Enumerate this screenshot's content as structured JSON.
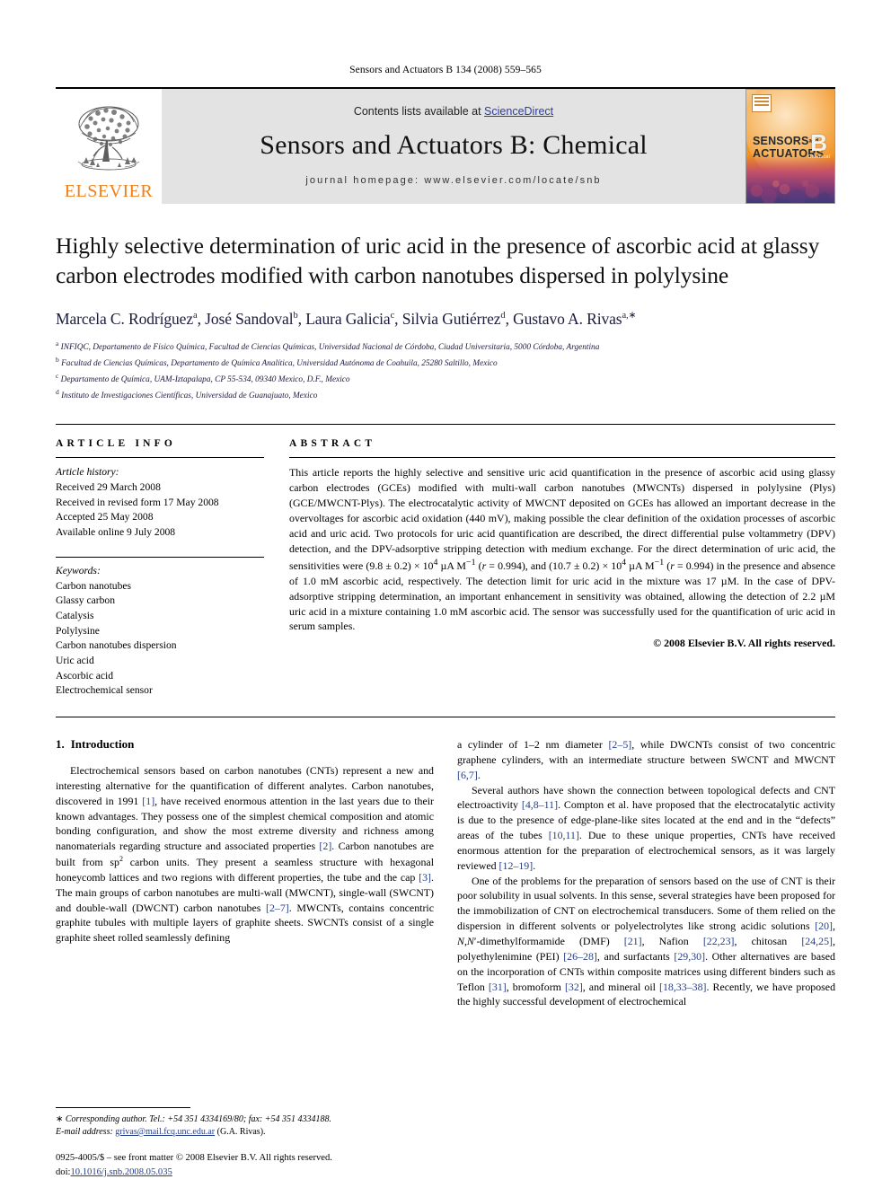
{
  "running_head": "Sensors and Actuators B 134 (2008) 559–565",
  "masthead": {
    "publisher_name": "ELSEVIER",
    "contents_prefix": "Contents lists available at ",
    "contents_link": "ScienceDirect",
    "journal_title": "Sensors and Actuators B: Chemical",
    "homepage_line": "journal homepage: www.elsevier.com/locate/snb",
    "cover": {
      "line1": "SENSORS",
      "and": "and",
      "line2": "ACTUATORS",
      "series": "B",
      "subtitle": "Chemical"
    }
  },
  "article": {
    "title": "Highly selective determination of uric acid in the presence of ascorbic acid at glassy carbon electrodes modified with carbon nanotubes dispersed in polylysine",
    "authors_html": "Marcela C. Rodríguez<sup>a</sup>, José Sandoval<sup>b</sup>, Laura Galicia<sup>c</sup>, Silvia Gutiérrez<sup>d</sup>, Gustavo A. Rivas<sup>a,</sup><sup class=\"star\">∗</sup>",
    "affiliations": [
      {
        "marker": "a",
        "text": "INFIQC, Departamento de Físico Química, Facultad de Ciencias Químicas, Universidad Nacional de Córdoba, Ciudad Universitaria, 5000 Córdoba, Argentina"
      },
      {
        "marker": "b",
        "text": "Facultad de Ciencias Químicas, Departamento de Química Analítica, Universidad Autónoma de Coahuila, 25280 Saltillo, Mexico"
      },
      {
        "marker": "c",
        "text": "Departamento de Química, UAM-Iztapalapa, CP 55-534, 09340 Mexico, D.F., Mexico"
      },
      {
        "marker": "d",
        "text": "Instituto de Investigaciones Científicas, Universidad de Guanajuato, Mexico"
      }
    ]
  },
  "article_info": {
    "heading": "ARTICLE INFO",
    "history_label": "Article history:",
    "history": [
      "Received 29 March 2008",
      "Received in revised form 17 May 2008",
      "Accepted 25 May 2008",
      "Available online 9 July 2008"
    ],
    "keywords_label": "Keywords:",
    "keywords": [
      "Carbon nanotubes",
      "Glassy carbon",
      "Catalysis",
      "Polylysine",
      "Carbon nanotubes dispersion",
      "Uric acid",
      "Ascorbic acid",
      "Electrochemical sensor"
    ]
  },
  "abstract": {
    "heading": "ABSTRACT",
    "text_html": "This article reports the highly selective and sensitive uric acid quantification in the presence of ascorbic acid using glassy carbon electrodes (GCEs) modified with multi-wall carbon nanotubes (MWCNTs) dispersed in polylysine (Plys) (GCE/MWCNT-Plys). The electrocatalytic activity of MWCNT deposited on GCEs has allowed an important decrease in the overvoltages for ascorbic acid oxidation (440 mV), making possible the clear definition of the oxidation processes of ascorbic acid and uric acid. Two protocols for uric acid quantification are described, the direct differential pulse voltammetry (DPV) detection, and the DPV-adsorptive stripping detection with medium exchange. For the direct determination of uric acid, the sensitivities were (9.8 ± 0.2) × 10<sup>4</sup> &micro;A M<sup>−1</sup> (<i>r</i> = 0.994), and (10.7 ± 0.2) × 10<sup>4</sup> &micro;A M<sup>−1</sup> (<i>r</i> = 0.994) in the presence and absence of 1.0 mM ascorbic acid, respectively. The detection limit for uric acid in the mixture was 17 &micro;M. In the case of DPV-adsorptive stripping determination, an important enhancement in sensitivity was obtained, allowing the detection of 2.2 &micro;M uric acid in a mixture containing 1.0 mM ascorbic acid. The sensor was successfully used for the quantification of uric acid in serum samples.",
    "copyright": "© 2008 Elsevier B.V. All rights reserved."
  },
  "introduction": {
    "number": "1.",
    "heading": "Introduction",
    "left_paragraphs_html": [
      "Electrochemical sensors based on carbon nanotubes (CNTs) represent a new and interesting alternative for the quantification of different analytes. Carbon nanotubes, discovered in 1991 <span class=\"ref\">[1]</span>, have received enormous attention in the last years due to their known advantages. They possess one of the simplest chemical composition and atomic bonding configuration, and show the most extreme diversity and richness among nanomaterials regarding structure and associated properties <span class=\"ref\">[2]</span>. Carbon nanotubes are built from sp<sup class=\"sp2\">2</sup> carbon units. They present a seamless structure with hexagonal honeycomb lattices and two regions with different properties, the tube and the cap <span class=\"ref\">[3]</span>. The main groups of carbon nanotubes are multi-wall (MWCNT), single-wall (SWCNT) and double-wall (DWCNT) carbon nanotubes <span class=\"ref\">[2–7]</span>. MWCNTs, contains concentric graphite tubules with multiple layers of graphite sheets. SWCNTs consist of a single graphite sheet rolled seamlessly defining"
    ],
    "right_paragraphs_html": [
      "a cylinder of 1–2 nm diameter <span class=\"ref\">[2–5]</span>, while DWCNTs consist of two concentric graphene cylinders, with an intermediate structure between SWCNT and MWCNT <span class=\"ref\">[6,7]</span>.",
      "Several authors have shown the connection between topological defects and CNT electroactivity <span class=\"ref\">[4,8–11]</span>. Compton et al. have proposed that the electrocatalytic activity is due to the presence of edge-plane-like sites located at the end and in the “defects” areas of the tubes <span class=\"ref\">[10,11]</span>. Due to these unique properties, CNTs have received enormous attention for the preparation of electrochemical sensors, as it was largely reviewed <span class=\"ref\">[12–19]</span>.",
      "One of the problems for the preparation of sensors based on the use of CNT is their poor solubility in usual solvents. In this sense, several strategies have been proposed for the immobilization of CNT on electrochemical transducers. Some of them relied on the dispersion in different solvents or polyelectrolytes like strong acidic solutions <span class=\"ref\">[20]</span>, <i>N</i>,<i>N</i>′-dimethylformamide (DMF) <span class=\"ref\">[21]</span>, Nafion <span class=\"ref\">[22,23]</span>, chitosan <span class=\"ref\">[24,25]</span>, polyethylenimine (PEI) <span class=\"ref\">[26–28]</span>, and surfactants <span class=\"ref\">[29,30]</span>. Other alternatives are based on the incorporation of CNTs within composite matrices using different binders such as Teflon <span class=\"ref\">[31]</span>, bromoform <span class=\"ref\">[32]</span>, and mineral oil <span class=\"ref\">[18,33–38]</span>. Recently, we have proposed the highly successful development of electrochemical"
    ]
  },
  "footnotes": {
    "corresponding_html": "<span class=\"nital\">∗</span> Corresponding author. Tel.: +54 351 4334169/80; fax: +54 351 4334188.",
    "email_label": "E-mail address:",
    "email": "grivas@mail.fcq.unc.edu.ar",
    "email_owner": "(G.A. Rivas)."
  },
  "imprint": {
    "line1": "0925-4005/$ – see front matter © 2008 Elsevier B.V. All rights reserved.",
    "doi_label": "doi:",
    "doi": "10.1016/j.snb.2008.05.035"
  },
  "colors": {
    "elsevier_orange": "#F07F1A",
    "link_blue": "#27408B",
    "sciencedirect_blue": "#2B3F9E",
    "masthead_gray": "#E3E3E3"
  }
}
